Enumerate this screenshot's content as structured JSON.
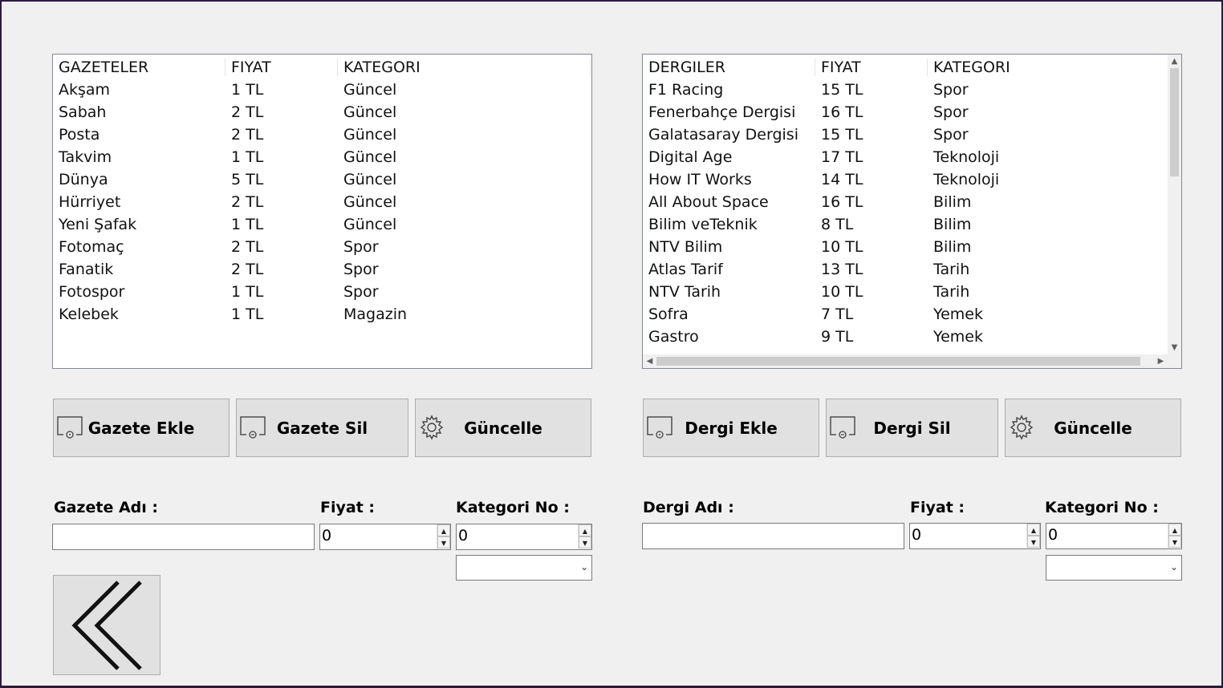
{
  "newspapers": {
    "headers": [
      "GAZETELER",
      "FIYAT",
      "KATEGORI"
    ],
    "rows": [
      [
        "Akşam",
        "1 TL",
        "Güncel"
      ],
      [
        "Sabah",
        "2 TL",
        "Güncel"
      ],
      [
        "Posta",
        "2 TL",
        "Güncel"
      ],
      [
        "Takvim",
        "1 TL",
        "Güncel"
      ],
      [
        "Dünya",
        "5 TL",
        "Güncel"
      ],
      [
        "Hürriyet",
        "2 TL",
        "Güncel"
      ],
      [
        "Yeni Şafak",
        "1 TL",
        "Güncel"
      ],
      [
        "Fotomaç",
        "2 TL",
        "Spor"
      ],
      [
        "Fanatik",
        "2 TL",
        "Spor"
      ],
      [
        "Fotospor",
        "1 TL",
        "Spor"
      ],
      [
        "Kelebek",
        "1 TL",
        "Magazin"
      ]
    ]
  },
  "magazines": {
    "headers": [
      "DERGILER",
      "FIYAT",
      "KATEGORI"
    ],
    "rows": [
      [
        "F1 Racing",
        "15 TL",
        "Spor"
      ],
      [
        "Fenerbahçe Dergisi",
        "16 TL",
        "Spor"
      ],
      [
        "Galatasaray Dergisi",
        "15 TL",
        "Spor"
      ],
      [
        "Digital Age",
        "17 TL",
        "Teknoloji"
      ],
      [
        "How IT Works",
        "14 TL",
        "Teknoloji"
      ],
      [
        "All About Space",
        "16 TL",
        "Bilim"
      ],
      [
        "Bilim veTeknik",
        "8 TL",
        "Bilim"
      ],
      [
        "NTV Bilim",
        "10 TL",
        "Bilim"
      ],
      [
        "Atlas Tarif",
        "13 TL",
        "Tarih"
      ],
      [
        "NTV Tarih",
        "10 TL",
        "Tarih"
      ],
      [
        "Sofra",
        "7 TL",
        "Yemek"
      ],
      [
        "Gastro",
        "9 TL",
        "Yemek"
      ]
    ]
  },
  "buttons": {
    "add_newspaper": "Gazete Ekle",
    "delete_newspaper": "Gazete Sil",
    "update_newspaper": "Güncelle",
    "add_magazine": "Dergi Ekle",
    "delete_magazine": "Dergi Sil",
    "update_magazine": "Güncelle"
  },
  "newspaper_form": {
    "name_label": "Gazete Adı :",
    "price_label": "Fiyat :",
    "category_label": "Kategori No :",
    "name_value": "",
    "price_value": "0",
    "category_value": "0",
    "category_select": ""
  },
  "magazine_form": {
    "name_label": "Dergi Adı :",
    "price_label": "Fiyat :",
    "category_label": "Kategori No :",
    "name_value": "",
    "price_value": "0",
    "category_value": "0",
    "category_select": ""
  },
  "icons": {
    "add": "add-document-icon",
    "delete": "remove-document-icon",
    "update": "gear-icon",
    "back": "double-chevron-left-icon"
  }
}
